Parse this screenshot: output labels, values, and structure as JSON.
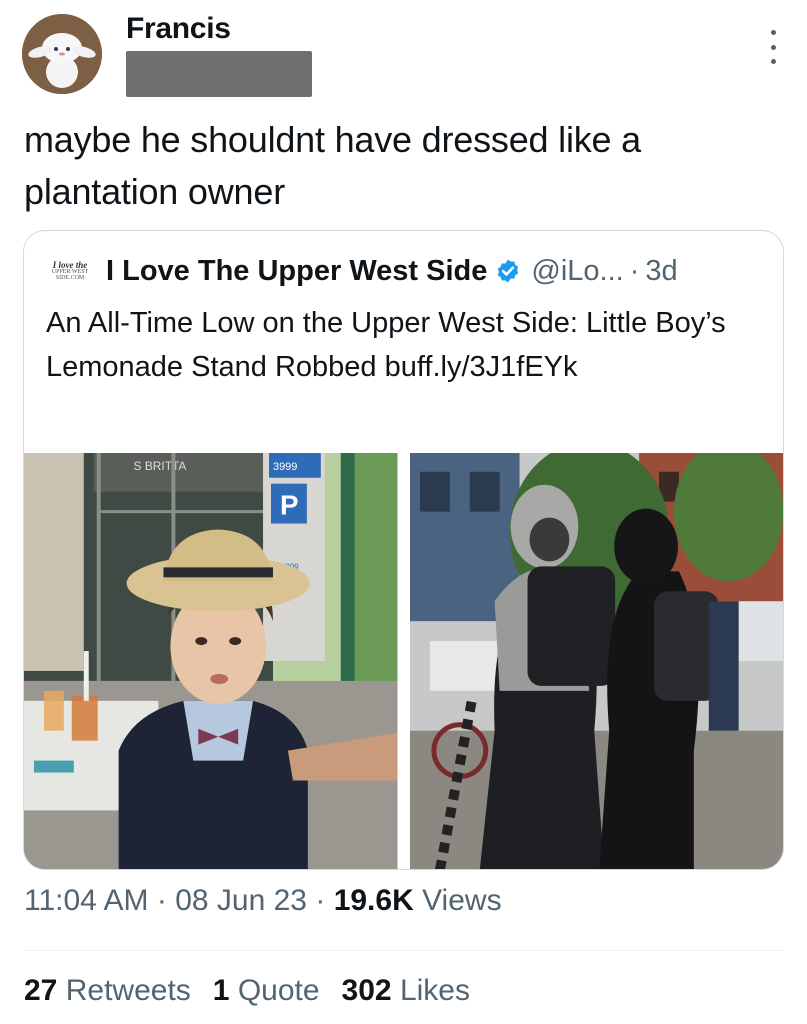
{
  "tweet": {
    "author_name": "Francis",
    "avatar_icon": "plush-toy-avatar",
    "text": "maybe he shouldnt have dressed like a plantation owner",
    "timestamp": "11:04 AM",
    "date": "08 Jun 23",
    "views_count": "19.6K",
    "views_label": "Views",
    "separator": "·"
  },
  "quote": {
    "name": "I Love The Upper West Side",
    "handle": "@iLo...",
    "age": "3d",
    "separator": "·",
    "logo_text": [
      "I love the",
      "UPPER WEST",
      "SIDE.COM"
    ],
    "text": "An All-Time Low on the Upper West Side: Little Boy’s Lemonade Stand Robbed buff.ly/3J1fEYk",
    "photo_text": [
      "3999",
      "P",
      "3999",
      "S BRITTA"
    ]
  },
  "stats": {
    "retweets_count": "27",
    "retweets_label": "Retweets",
    "quotes_count": "1",
    "quotes_label": "Quote",
    "likes_count": "302",
    "likes_label": "Likes"
  },
  "colors": {
    "text": "#0f1419",
    "secondary": "#536471",
    "border": "#cfd9de",
    "verified": "#1d9bf0"
  }
}
